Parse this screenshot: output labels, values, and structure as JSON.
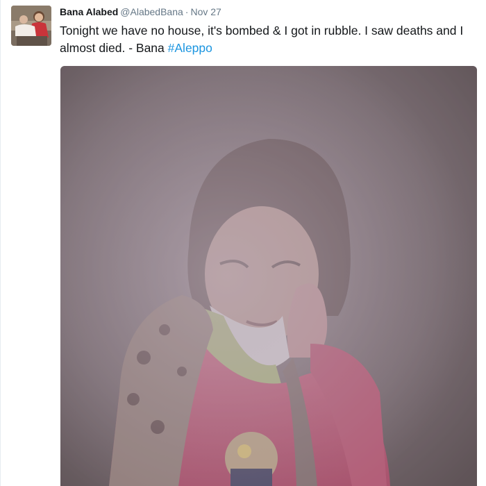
{
  "tweet": {
    "author_name": "Bana Alabed",
    "author_handle": "@AlabedBana",
    "separator": "·",
    "date": "Nov 27",
    "text_main": "Tonight we have no house, it's bombed & I got in rubble. I saw deaths and I almost died. - Bana",
    "hashtag": "#Aleppo"
  },
  "colors": {
    "text": "#14171a",
    "secondary": "#657786",
    "link": "#1b95e0"
  },
  "icons": {
    "avatar": "avatar-photo",
    "media": "photo-girl-in-dust"
  }
}
